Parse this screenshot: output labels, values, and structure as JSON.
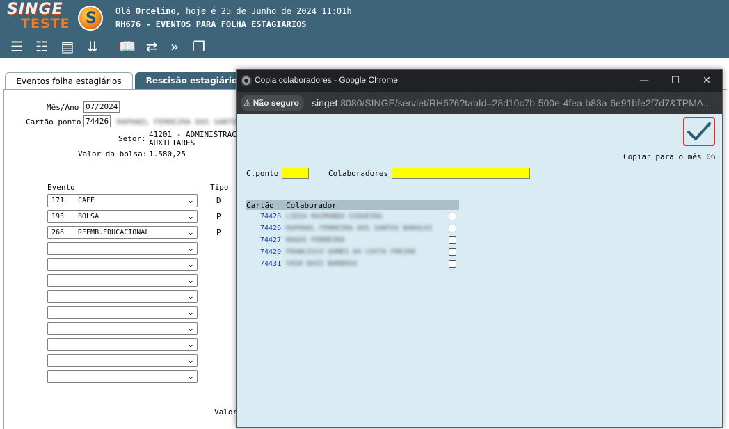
{
  "header": {
    "logo_line1": "SINGE",
    "logo_line2": "TESTE",
    "emblem_letter": "S",
    "greeting_prefix": "Olá",
    "user": "Orcelino",
    "greeting_suffix": ", hoje é 25 de Junho de 2024 11:01h",
    "page_title": "RH676 - EVENTOS PARA FOLHA ESTAGIARIOS"
  },
  "toolbar": {
    "icons": [
      "list-icon",
      "checklist-icon",
      "card-icon",
      "chevrons-down-icon",
      "book-icon",
      "refresh-icon",
      "double-chevron-right-icon",
      "copy-pages-icon"
    ]
  },
  "tabs": {
    "active": "Eventos folha estagiários",
    "inactive": "Rescisão estagiários"
  },
  "form": {
    "mes_ano_label": "Mês/Ano",
    "mes_ano_value": "07/2024",
    "cartao_label": "Cartão ponto",
    "cartao_value": "74426",
    "employee_name": "RAPHAEL FERREIRA DOS SANTOS",
    "setor_label": "Setor:",
    "setor_line1": "41201 - ADMINISTRACA",
    "setor_line2": "AUXILIARES",
    "bolsa_label": "Valor da bolsa:",
    "bolsa_value": "1.580,25",
    "evento_header": "Evento",
    "tipo_header": "Tipo",
    "valor_label": "Valor",
    "events": [
      {
        "code": "171",
        "name": "CAFE",
        "tipo": "D"
      },
      {
        "code": "193",
        "name": "BOLSA",
        "tipo": "P"
      },
      {
        "code": "266",
        "name": "REEMB.EDUCACIONAL",
        "tipo": "P"
      },
      {
        "code": "",
        "name": "",
        "tipo": ""
      },
      {
        "code": "",
        "name": "",
        "tipo": ""
      },
      {
        "code": "",
        "name": "",
        "tipo": ""
      },
      {
        "code": "",
        "name": "",
        "tipo": ""
      },
      {
        "code": "",
        "name": "",
        "tipo": ""
      },
      {
        "code": "",
        "name": "",
        "tipo": ""
      },
      {
        "code": "",
        "name": "",
        "tipo": ""
      },
      {
        "code": "",
        "name": "",
        "tipo": ""
      },
      {
        "code": "",
        "name": "",
        "tipo": ""
      }
    ]
  },
  "popup": {
    "title": "Copia colaboradores - Google Chrome",
    "minimize": "—",
    "maximize": "☐",
    "close": "✕",
    "security_label": "Não seguro",
    "url_host": "singet",
    "url_path": ":8080/SINGE/servlet/RH676?tabId=28d10c7b-500e-4fea-b83a-6e91bfe2f7d7&TPMA...",
    "copy_label": "Copiar para o mês 06",
    "cponto_label": "C.ponto",
    "colaboradores_label": "Colaboradores",
    "col_cartao": "Cartão",
    "col_colaborador": "Colaborador",
    "rows": [
      {
        "card": "74428",
        "name": "LIDIA RAIMUNDO SIQUEIRA"
      },
      {
        "card": "74426",
        "name": "RAPHAEL FERREIRA DOS SANTOS BARALDI"
      },
      {
        "card": "74427",
        "name": "HUGAS FERREIRA"
      },
      {
        "card": "74429",
        "name": "FRANCISCO GOMES DA COSTA FREIRE"
      },
      {
        "card": "74431",
        "name": "YASH DAIS BARBOSA"
      }
    ]
  },
  "colors": {
    "header_bg": "#3d6478",
    "popup_bg": "#d9ecf4",
    "highlight_input": "#ffff00",
    "confirm_border": "#e03030",
    "check_color": "#2d5f73"
  }
}
